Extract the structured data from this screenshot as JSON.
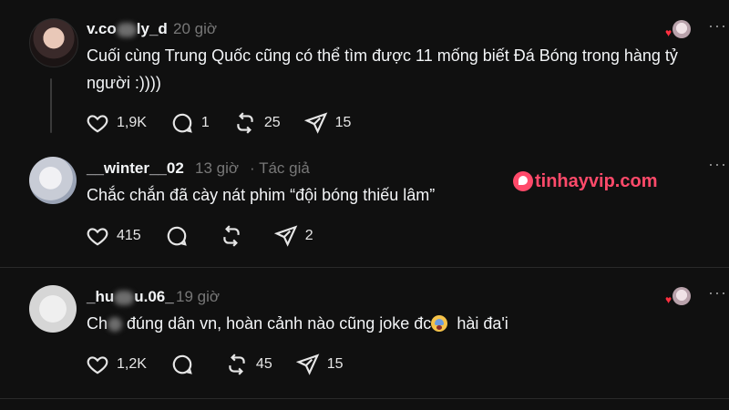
{
  "watermark": {
    "text": "tinhayvip.com"
  },
  "posts": [
    {
      "username": "v.co",
      "username_tail": "ly_d",
      "time": "20 giờ",
      "text": "Cuối cùng Trung Quốc cũng có thể tìm được 11 mống biết Đá Bóng trong hàng tỷ\nngười :))))",
      "likes": "1,9K",
      "replies": "1",
      "reposts": "25",
      "shares": "15",
      "liked_by_author": true
    },
    {
      "username": "__winter__02",
      "time": "13 giờ",
      "author_tag": "· Tác giả",
      "text": "Chắc chắn đã cày nát phim “đội bóng thiếu lâm”",
      "likes": "415",
      "replies": "",
      "reposts": "",
      "shares": "2",
      "liked_by_author": false
    },
    {
      "username": "_hu",
      "username_tail": "u.06_",
      "time": "19 giờ",
      "text_prefix": "Ch",
      "text": "đúng dân vn, hoàn cảnh nào cũng joke đc",
      "text_suffix": "hài đa'i",
      "likes": "1,2K",
      "replies": "",
      "reposts": "45",
      "shares": "15",
      "liked_by_author": true
    }
  ],
  "icons": [
    "heart-icon",
    "comment-icon",
    "repost-icon",
    "share-icon",
    "more-icon"
  ],
  "colors": {
    "background": "#101010",
    "text": "#f3f5f7",
    "muted": "#777777",
    "accent": "#ff4a6a"
  }
}
